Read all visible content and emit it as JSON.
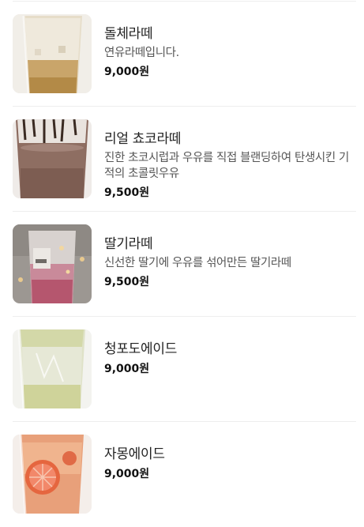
{
  "menu": {
    "items": [
      {
        "name": "돌체라떼",
        "description": "연유라떼입니다.",
        "price": "9,000원",
        "image_icon": "dolce-latte-photo"
      },
      {
        "name": "리얼 쵸코라떼",
        "description": "진한 초코시럽과 우유를 직접 블랜딩하여 탄생시킨 기적의 초콜릿우유",
        "price": "9,500원",
        "image_icon": "choco-latte-photo"
      },
      {
        "name": "딸기라떼",
        "description": "신선한 딸기에 우유를 섞어만든 딸기라떼",
        "price": "9,500원",
        "image_icon": "strawberry-latte-photo"
      },
      {
        "name": "청포도에이드",
        "description": "",
        "price": "9,000원",
        "image_icon": "green-grape-ade-photo"
      },
      {
        "name": "자몽에이드",
        "description": "",
        "price": "9,000원",
        "image_icon": "grapefruit-ade-photo"
      }
    ]
  }
}
